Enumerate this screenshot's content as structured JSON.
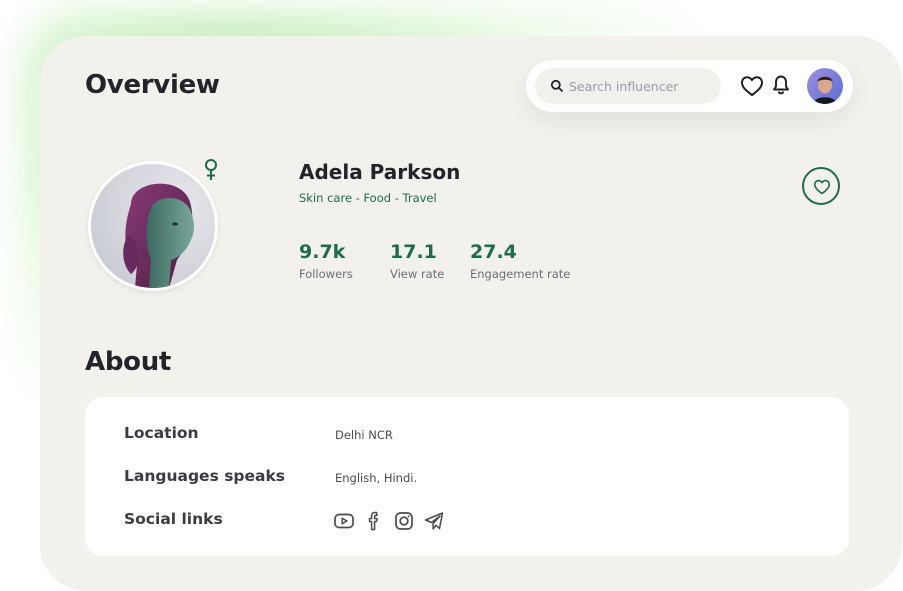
{
  "header": {
    "title": "Overview",
    "search_placeholder": "Search influencer",
    "icons": [
      "search-icon",
      "heart-icon",
      "bell-icon",
      "user-avatar"
    ]
  },
  "profile": {
    "name": "Adela Parkson",
    "tags": "Skin care - Food - Travel",
    "gender_icon": "female-symbol-icon",
    "favorite_icon": "heart-icon",
    "stats": [
      {
        "value": "9.7k",
        "label": "Followers"
      },
      {
        "value": "17.1",
        "label": "View rate"
      },
      {
        "value": "27.4",
        "label": "Engagement rate"
      }
    ]
  },
  "about": {
    "title": "About",
    "rows": [
      {
        "label": "Location",
        "value": "Delhi NCR"
      },
      {
        "label": "Languages speaks",
        "value": "English, Hindi."
      },
      {
        "label": "Social links",
        "value": ""
      }
    ],
    "social_links": [
      "youtube-icon",
      "facebook-icon",
      "instagram-icon",
      "telegram-icon"
    ]
  },
  "colors": {
    "accent": "#1e6b4e",
    "card_background": "#f2f1eb",
    "text_dark": "#23232b"
  }
}
